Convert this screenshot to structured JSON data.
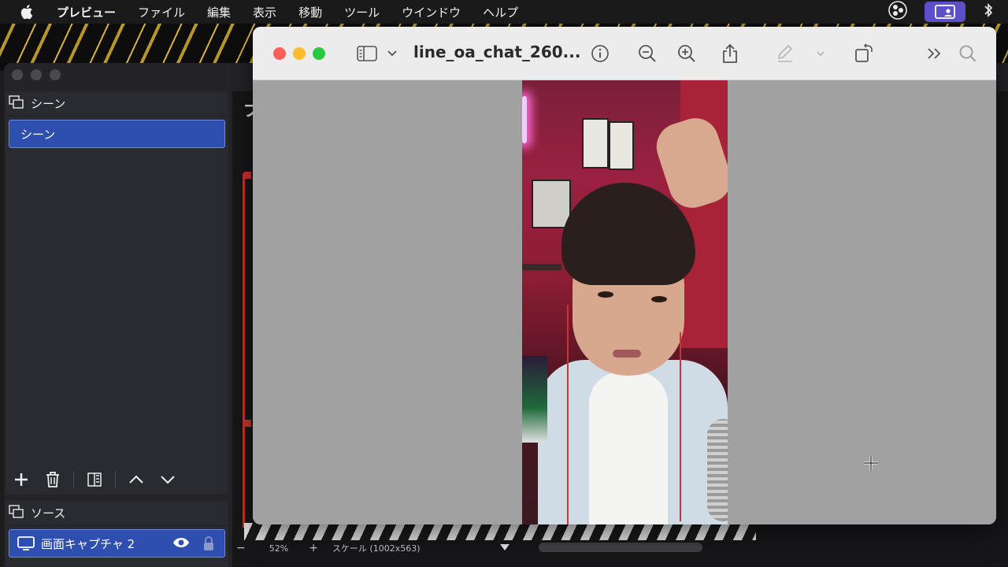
{
  "menubar": {
    "app_name": "プレビュー",
    "items": [
      "ファイル",
      "編集",
      "表示",
      "移動",
      "ツール",
      "ウインドウ",
      "ヘルプ"
    ]
  },
  "preview_window": {
    "title": "line_oa_chat_260..."
  },
  "obs": {
    "scenes_header": "シーン",
    "scene_items": [
      "シーン"
    ],
    "sources_header": "ソース",
    "source_items": [
      "画面キャプチャ 2"
    ],
    "preview_title_partial": "プ",
    "status": {
      "zoom_out": "−",
      "zoom": "52%",
      "zoom_in": "+",
      "scale": "スケール (1002x563)"
    }
  },
  "colors": {
    "accent_blue": "#2f4fb0",
    "close": "#fe5f57",
    "minimize": "#febc2e",
    "zoom": "#28c840",
    "control_center": "#5d4fc9"
  }
}
